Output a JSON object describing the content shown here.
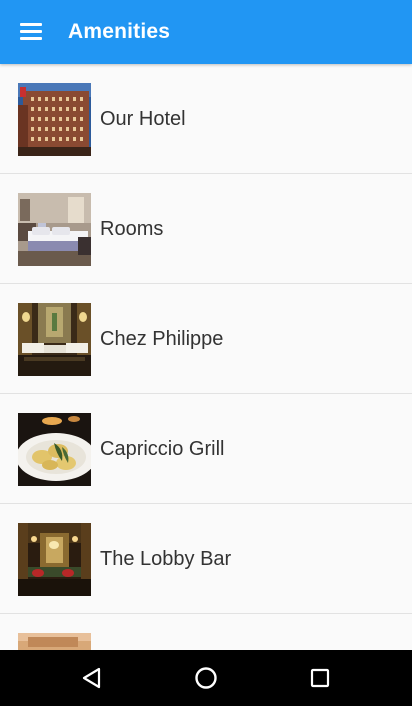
{
  "app_bar": {
    "title": "Amenities",
    "background_color": "#2196f3",
    "menu_icon": "hamburger-menu-icon"
  },
  "amenities": [
    {
      "label": "Our Hotel",
      "thumbnail": "hotel-exterior-photo"
    },
    {
      "label": "Rooms",
      "thumbnail": "hotel-room-photo"
    },
    {
      "label": "Chez Philippe",
      "thumbnail": "restaurant-dining-room-photo"
    },
    {
      "label": "Capriccio Grill",
      "thumbnail": "ravioli-dish-photo"
    },
    {
      "label": "The Lobby Bar",
      "thumbnail": "lobby-bar-photo"
    },
    {
      "label": "",
      "thumbnail": "partially-visible-photo"
    }
  ],
  "system_nav": {
    "back_icon": "back-triangle-icon",
    "home_icon": "home-circle-icon",
    "recents_icon": "recents-square-icon"
  }
}
